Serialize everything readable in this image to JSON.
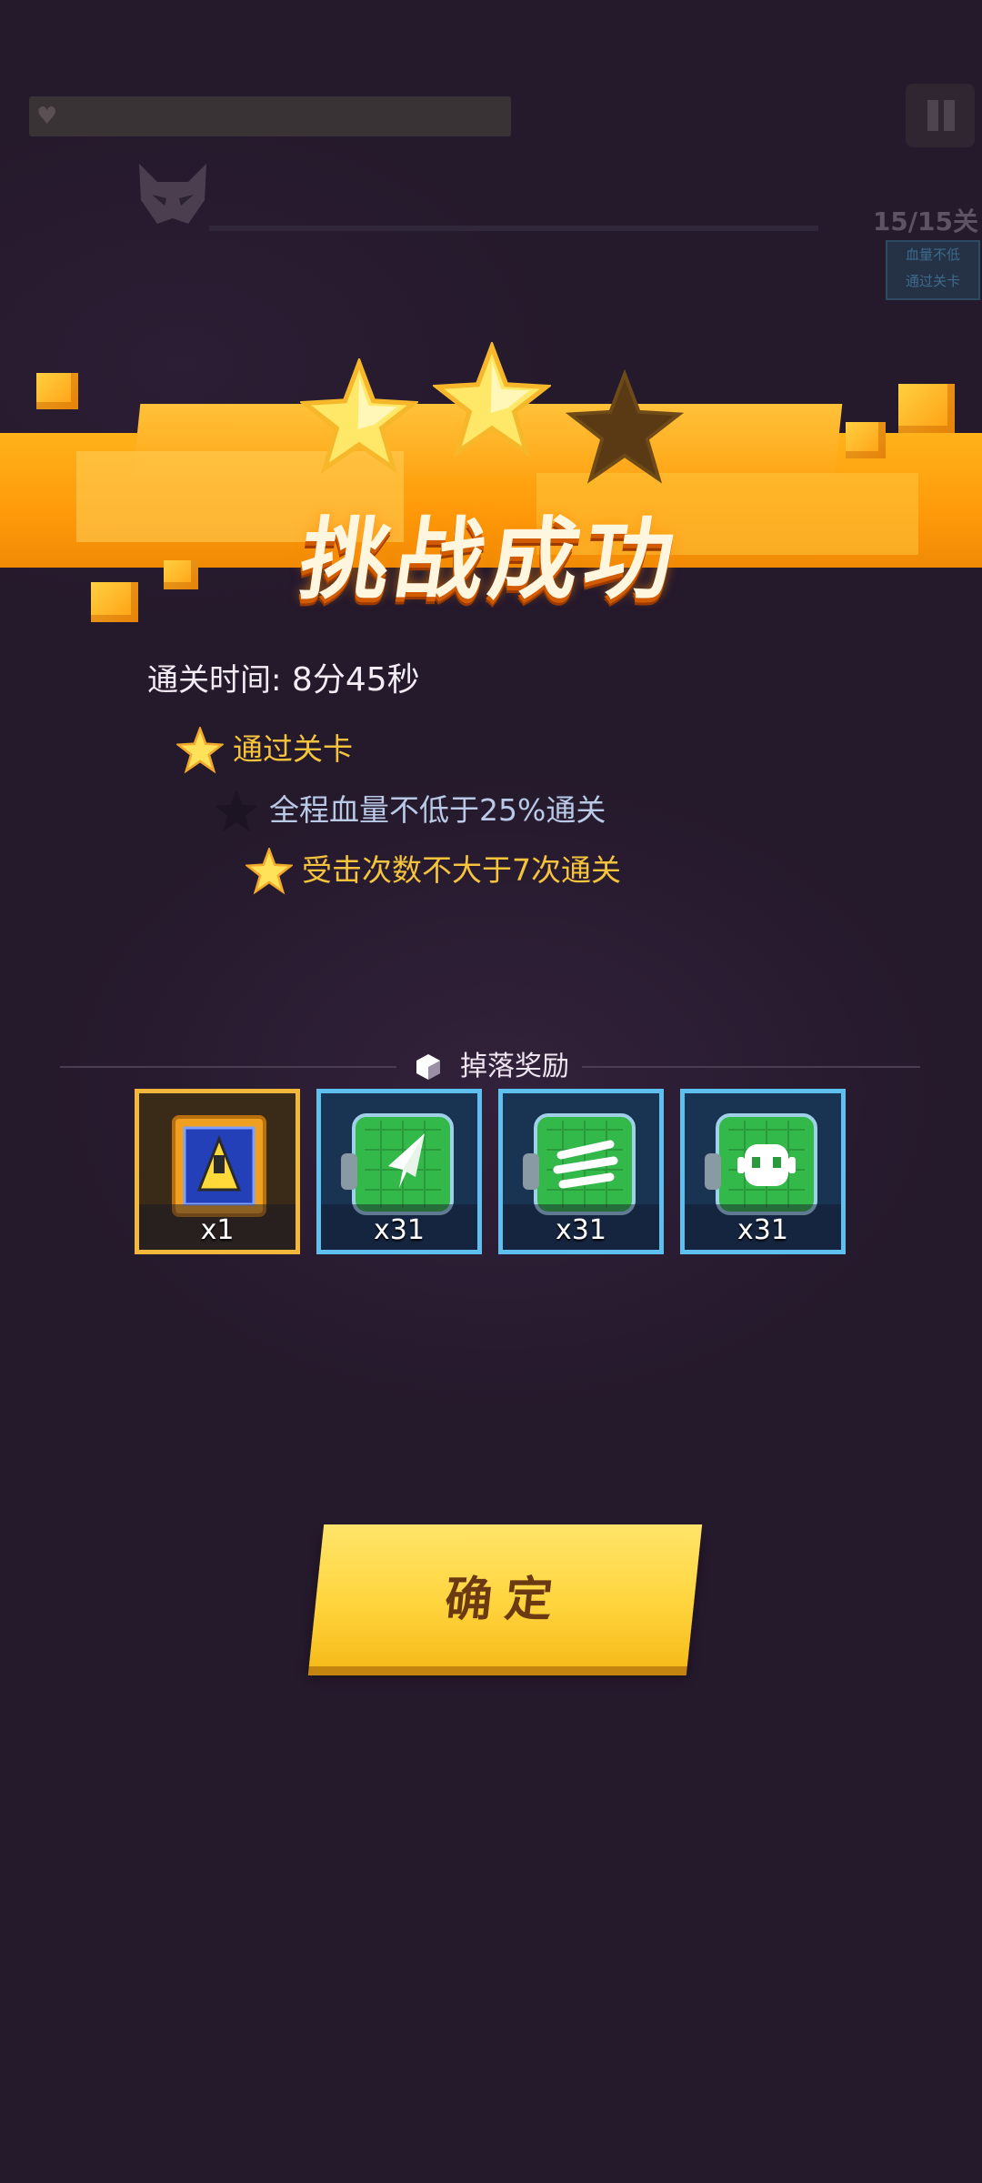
{
  "hud": {
    "stage_progress": "15/15关",
    "tag_text": "血量不低\n通过关卡"
  },
  "result": {
    "title": "挑战成功",
    "stars_earned": 2,
    "stars_total": 3,
    "clear_time_label": "通关时间:",
    "clear_time_value": "8分45秒"
  },
  "conditions": [
    {
      "text": "通过关卡",
      "achieved": true
    },
    {
      "text": "全程血量不低于25%通关",
      "achieved": false
    },
    {
      "text": "受击次数不大于7次通关",
      "achieved": true
    }
  ],
  "rewards": {
    "header": "掉落奖励",
    "items": [
      {
        "icon": "yellow-fighter-jet-icon",
        "count": "x1",
        "rarity": "gold"
      },
      {
        "icon": "rocket-chip-icon",
        "count": "x31",
        "rarity": "blue"
      },
      {
        "icon": "speed-chip-icon",
        "count": "x31",
        "rarity": "blue"
      },
      {
        "icon": "robot-chip-icon",
        "count": "x31",
        "rarity": "blue"
      }
    ]
  },
  "confirm_label": "确定",
  "colors": {
    "background": "#25192c",
    "banner": "#ffa515",
    "achieved": "#f6c43c",
    "not_achieved": "#b9c9e6",
    "rare_border": "#5fc0f0",
    "gold_border": "#f3b73c"
  }
}
